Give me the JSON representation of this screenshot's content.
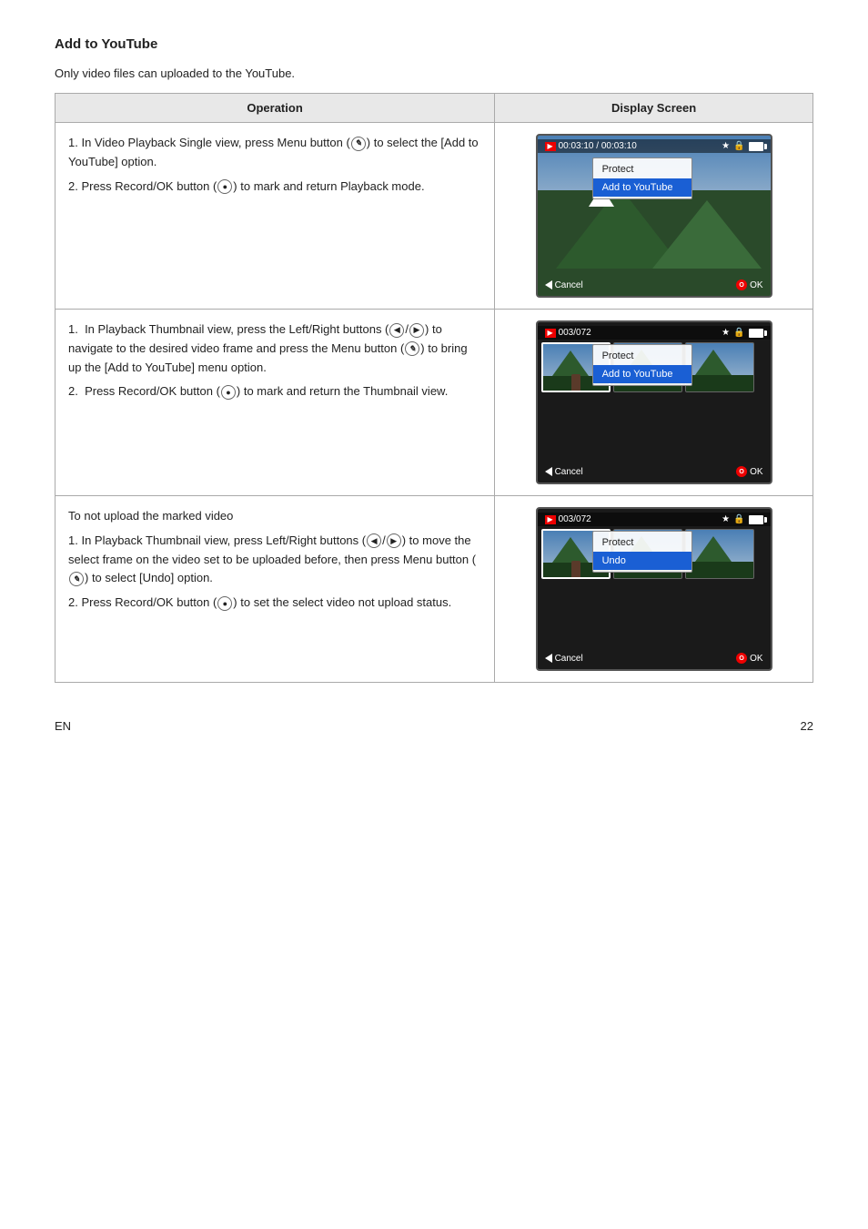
{
  "page": {
    "title": "Add to YouTube",
    "intro": "Only video files can uploaded to the YouTube.",
    "table": {
      "col1_header": "Operation",
      "col2_header": "Display Screen"
    },
    "rows": [
      {
        "operation": {
          "steps": [
            "1. In Video Playback Single view, press Menu button ( ) to select the [Add to YouTube] option.",
            "2. Press Record/OK button ( ) to mark and return Playback mode."
          ]
        },
        "display": {
          "type": "single_view",
          "counter": "00:03:10 / 00:03:10",
          "menu_items": [
            "Protect",
            "Add to YouTube"
          ],
          "selected_item": "Add to YouTube"
        }
      },
      {
        "operation": {
          "steps": [
            "1.  In Playback Thumbnail view, press the Left/Right buttons ( ) to navigate to the desired video frame and press the Menu button ( ) to bring up the [Add to YouTube] menu option.",
            "2.  Press Record/OK button ( ) to mark and return the Thumbnail view."
          ]
        },
        "display": {
          "type": "thumb_view",
          "counter": "003/072",
          "menu_items": [
            "Protect",
            "Add to YouTube"
          ],
          "selected_item": "Add to YouTube"
        }
      },
      {
        "operation": {
          "steps": [
            "To not upload the marked video",
            "1. In Playback Thumbnail view, press Left/Right buttons ( ) to move the select frame on the video set to be uploaded before, then press Menu button ( ) to select [Undo] option.",
            "2. Press Record/OK button ( ) to set the select video not upload status."
          ]
        },
        "display": {
          "type": "thumb_view_undo",
          "counter": "003/072",
          "menu_items": [
            "Protect",
            "Undo"
          ],
          "selected_item": "Undo"
        }
      }
    ],
    "footer": {
      "lang": "EN",
      "page_number": "22"
    }
  }
}
